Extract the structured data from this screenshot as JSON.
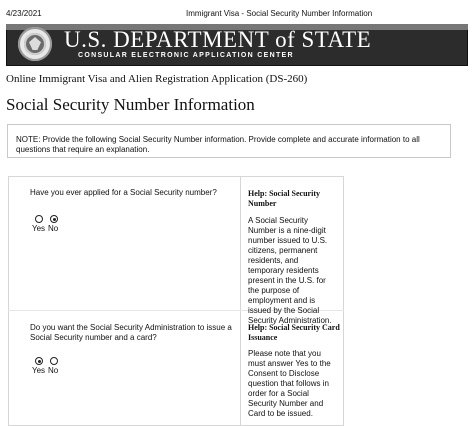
{
  "print_header": {
    "date": "4/23/2021",
    "title": "Immigrant Visa - Social Security Number Information"
  },
  "banner": {
    "title": "U.S. DEPARTMENT of STATE",
    "subtitle": "CONSULAR ELECTRONIC APPLICATION CENTER"
  },
  "application_title": "Online Immigrant Visa and Alien Registration Application (DS-260)",
  "section_title": "Social Security Number Information",
  "note": "NOTE: Provide the following Social Security Number information. Provide complete and accurate information to all questions that require an explanation.",
  "questions": [
    {
      "text": "Have you ever applied for a Social Security number?",
      "options": [
        "Yes",
        "No"
      ],
      "selected": "No",
      "help_title": "Help: Social Security Number",
      "help_text": "A Social Security Number is a nine-digit number issued to U.S. citizens, permanent residents, and temporary residents present in the U.S. for the purpose of employment and is issued by the Social Security Administration."
    },
    {
      "text": "Do you want the Social Security Administration to issue a Social Security number and a card?",
      "options": [
        "Yes",
        "No"
      ],
      "selected": "Yes",
      "help_title": "Help: Social Security Card Issuance",
      "help_text": "Please note that you must answer Yes to the Consent to Disclose question that follows in order for a Social Security Number and Card to be issued."
    }
  ]
}
